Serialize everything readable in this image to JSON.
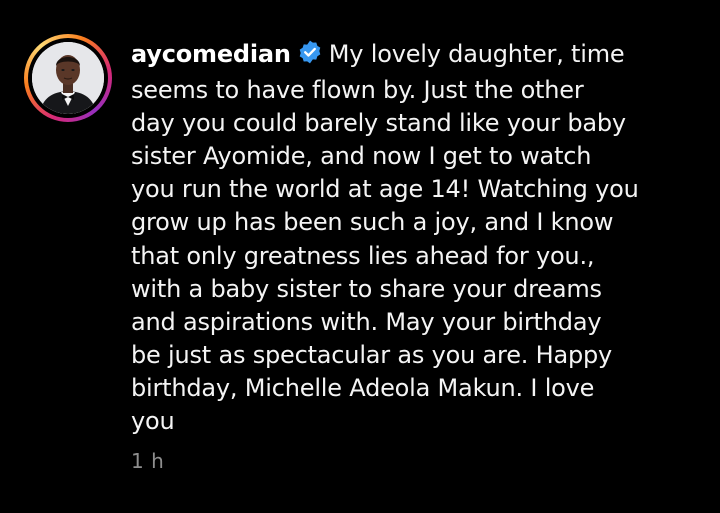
{
  "comment": {
    "username": "aycomedian",
    "verified_icon": "verified-badge-icon",
    "first_line_text": "My lovely daughter, time",
    "lines": [
      "seems to have flown by. Just the other",
      "day you could barely stand like your baby",
      "sister Ayomide, and now I get to watch",
      "you run the world at age 14! Watching you",
      "grow up has been such a joy, and I know",
      "that only greatness lies ahead for you.,",
      "with a baby sister to share your dreams",
      "and aspirations with.  May your birthday",
      "be just as spectacular as you are. Happy",
      "birthday, Michelle Adeola Makun. I love",
      "you"
    ],
    "timestamp": "1 h"
  },
  "colors": {
    "background": "#000000",
    "text": "#f4f4f4",
    "muted": "#8e8e8e",
    "verified": "#3797f0"
  }
}
